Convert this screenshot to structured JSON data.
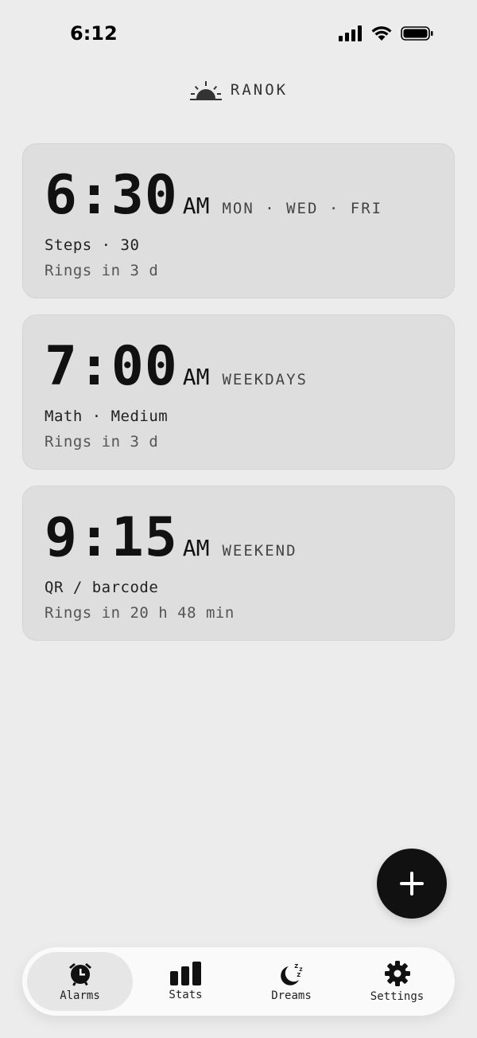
{
  "status_bar": {
    "time": "6:12"
  },
  "brand": {
    "name": "RANOK"
  },
  "alarms": [
    {
      "time": "6:30",
      "ampm": "AM",
      "days": "MON · WED · FRI",
      "challenge": "Steps · 30",
      "rings": "Rings in 3 d"
    },
    {
      "time": "7:00",
      "ampm": "AM",
      "days": "WEEKDAYS",
      "challenge": "Math · Medium",
      "rings": "Rings in 3 d"
    },
    {
      "time": "9:15",
      "ampm": "AM",
      "days": "WEEKEND",
      "challenge": "QR / barcode",
      "rings": "Rings in 20 h 48 min"
    }
  ],
  "tabs": [
    {
      "label": "Alarms",
      "icon": "alarm-clock-icon",
      "active": true
    },
    {
      "label": "Stats",
      "icon": "bar-chart-icon",
      "active": false
    },
    {
      "label": "Dreams",
      "icon": "moon-zzz-icon",
      "active": false
    },
    {
      "label": "Settings",
      "icon": "gear-icon",
      "active": false
    }
  ],
  "colors": {
    "background": "#ececec",
    "card": "#dedede",
    "accent": "#111111",
    "tab_bar": "#fafafa"
  }
}
